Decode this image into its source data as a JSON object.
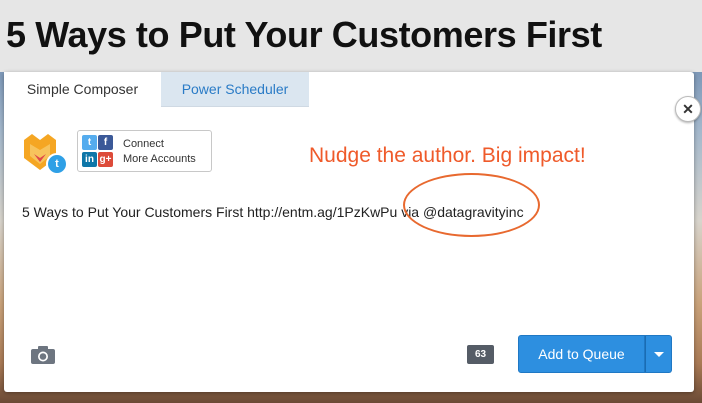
{
  "article": {
    "title": "5 Ways to Put Your Customers First"
  },
  "composer": {
    "tabs": [
      {
        "label": "Simple Composer",
        "active": true
      },
      {
        "label": "Power Scheduler",
        "active": false
      }
    ],
    "close_icon": "close-icon",
    "connect": {
      "line1": "Connect",
      "line2": "More Accounts",
      "networks": [
        "t",
        "f",
        "in",
        "g+"
      ]
    },
    "profile_badge": "t",
    "tweet_text": "5 Ways to Put Your Customers First http://entm.ag/1PzKwPu via @datagravityinc",
    "char_count": "63",
    "add_button": "Add to Queue"
  },
  "annotation": {
    "text": "Nudge the author. Big impact!",
    "color": "#ef5a2a"
  },
  "colors": {
    "accent": "#2d8fe0",
    "annotation": "#e8692f"
  }
}
